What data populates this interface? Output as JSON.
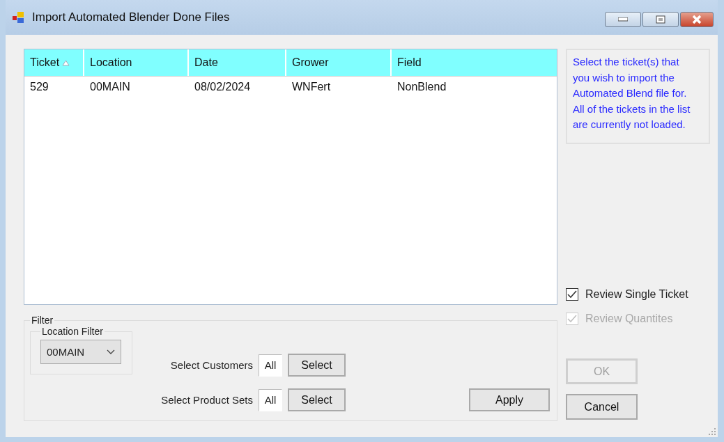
{
  "window": {
    "title": "Import Automated Blender Done Files"
  },
  "table": {
    "columns": [
      {
        "label": "Ticket",
        "sorted": true
      },
      {
        "label": "Location",
        "sorted": false
      },
      {
        "label": "Date",
        "sorted": false
      },
      {
        "label": "Grower",
        "sorted": false
      },
      {
        "label": "Field",
        "sorted": false
      }
    ],
    "rows": [
      [
        "529",
        "00MAIN",
        "08/02/2024",
        "WNFert",
        "NonBlend"
      ]
    ]
  },
  "info": "Select the ticket(s) that you wish to import the Automated Blend file for. All of the tickets in the list are currently not loaded.",
  "filter": {
    "title": "Filter",
    "location_filter": {
      "title": "Location Filter",
      "value": "00MAIN"
    },
    "rows": [
      {
        "label": "Select Customers",
        "value": "All",
        "button": "Select"
      },
      {
        "label": "Select Product Sets",
        "value": "All",
        "button": "Select"
      }
    ],
    "apply": "Apply"
  },
  "options": [
    {
      "label": "Review Single Ticket",
      "checked": true,
      "disabled": false
    },
    {
      "label": "Review Quantites",
      "checked": true,
      "disabled": true
    }
  ],
  "buttons": [
    {
      "label": "OK",
      "disabled": true
    },
    {
      "label": "Cancel",
      "disabled": false
    }
  ]
}
